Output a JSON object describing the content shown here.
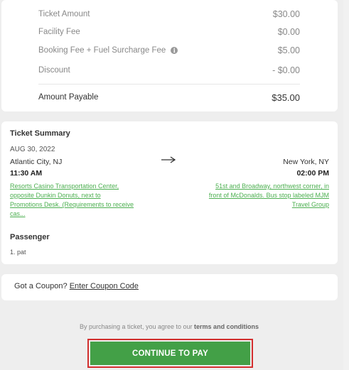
{
  "fees": {
    "rows": [
      {
        "label": "Ticket Amount",
        "value": "$30.00"
      },
      {
        "label": "Facility Fee",
        "value": "$0.00"
      },
      {
        "label": "Booking Fee + Fuel Surcharge Fee",
        "value": "$5.00",
        "icon": "info-icon"
      },
      {
        "label": "Discount",
        "value": "- $0.00"
      }
    ],
    "total": {
      "label": "Amount Payable",
      "value": "$35.00"
    }
  },
  "summary": {
    "title": "Ticket Summary",
    "date": "AUG 30, 2022",
    "origin": {
      "city": "Atlantic City, NJ",
      "time": "11:30 AM",
      "location_lines": [
        "Resorts Casino Transportation Center,",
        "opposite Dunkin Donuts, next to",
        "Promotions Desk. (Requirements to receive",
        "cas..."
      ]
    },
    "destination": {
      "city": "New York, NY",
      "time": "02:00 PM",
      "location_lines": [
        "51st and Broadway, northwest corner, in",
        "front of McDonalds. Bus stop labeled MJM",
        "Travel Group"
      ]
    },
    "arrow_icon": "arrow-right-icon",
    "passenger_title": "Passenger",
    "passenger": "1. pat"
  },
  "coupon": {
    "prompt": "Got a Coupon?",
    "link": "Enter Coupon Code"
  },
  "terms": {
    "prefix": "By purchasing a ticket, you agree to our",
    "link": "terms and conditions"
  },
  "pay_button": "CONTINUE TO PAY",
  "colors": {
    "accent": "#43a047",
    "highlight": "#d32f2f",
    "background": "#eeeeee"
  }
}
